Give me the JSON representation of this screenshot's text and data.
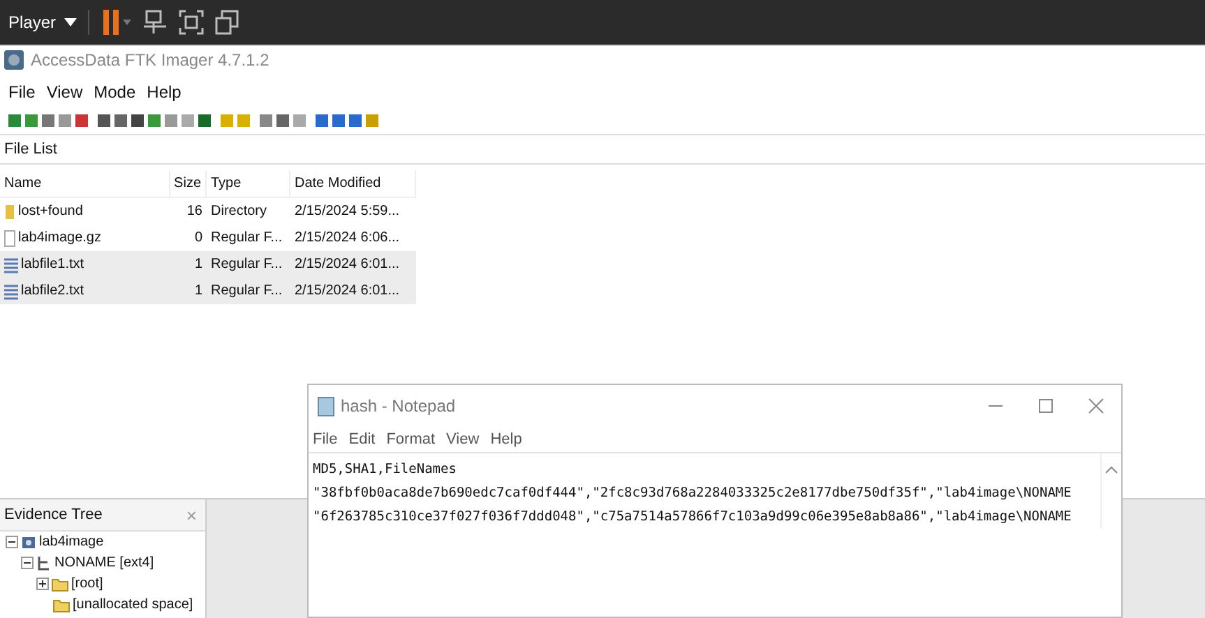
{
  "player_bar": {
    "label": "Player"
  },
  "window": {
    "title": "AccessData FTK Imager 4.7.1.2"
  },
  "menu": [
    "File",
    "View",
    "Mode",
    "Help"
  ],
  "file_list": {
    "title": "File List",
    "columns": [
      "Name",
      "Size",
      "Type",
      "Date Modified"
    ],
    "rows": [
      {
        "kind": "folder",
        "name": "lost+found",
        "size": "16",
        "type": "Directory",
        "date": "2/15/2024 5:59...",
        "selected": false
      },
      {
        "kind": "file",
        "name": "lab4image.gz",
        "size": "0",
        "type": "Regular F...",
        "date": "2/15/2024 6:06...",
        "selected": false
      },
      {
        "kind": "text",
        "name": "labfile1.txt",
        "size": "1",
        "type": "Regular F...",
        "date": "2/15/2024 6:01...",
        "selected": true
      },
      {
        "kind": "text",
        "name": "labfile2.txt",
        "size": "1",
        "type": "Regular F...",
        "date": "2/15/2024 6:01...",
        "selected": true
      }
    ]
  },
  "evidence_tree": {
    "title": "Evidence Tree",
    "close": "×",
    "items": [
      {
        "label": "lab4image",
        "kind": "image",
        "expanded": true,
        "children": [
          {
            "label": "NONAME [ext4]",
            "kind": "partition",
            "expanded": true,
            "children": [
              {
                "label": "[root]",
                "kind": "folder",
                "expanded": false
              },
              {
                "label": "[unallocated space]",
                "kind": "folder"
              }
            ]
          }
        ]
      }
    ]
  },
  "notepad": {
    "title": "hash - Notepad",
    "menu": [
      "File",
      "Edit",
      "Format",
      "View",
      "Help"
    ],
    "lines": [
      "MD5,SHA1,FileNames",
      "\"38fbf0b0aca8de7b690edc7caf0df444\",\"2fc8c93d768a2284033325c2e8177dbe750df35f\",\"lab4image\\NONAME",
      "\"6f263785c310ce37f027f036f7ddd048\",\"c75a7514a57866f7c103a9d99c06e395e8ab8a86\",\"lab4image\\NONAME"
    ]
  }
}
